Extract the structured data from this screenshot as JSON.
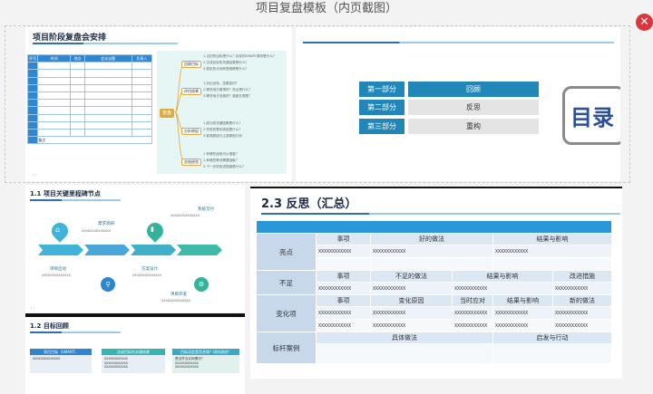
{
  "window": {
    "title": "项目复盘模板（内页截图）",
    "close_glyph": "✕"
  },
  "slide1": {
    "title": "项目阶段复盘会安排",
    "table_headers": [
      "序号",
      "时间",
      "地点",
      "会议议题",
      "负责人"
    ],
    "table_footer_label": "备注",
    "center_node": "复盘",
    "branches": [
      {
        "label": "回顾目标",
        "items": [
          "1.当初的目标是什么？目标的SMART原则是什么？",
          "2.达成目标的关键结果是什么？",
          "3.原定的计划和里程碑是什么？"
        ]
      },
      {
        "label": "评估结果",
        "items": [
          "1.对比目标，结果如何？",
          "2.哪些地方做得好？亮点是什么？",
          "3.哪些地方没做好？差距在哪里？"
        ]
      },
      {
        "label": "分析原因",
        "items": [
          "1.成功的关键因素是什么？",
          "2.失败的根本原因是什么？",
          "3.客观原因与主观原因分析"
        ]
      },
      {
        "label": "总结经验",
        "items": [
          "1.有哪些经验可以借鉴？",
          "2.有哪些教训需要吸取？",
          "3.下一步的改进措施是什么？"
        ]
      }
    ],
    "pager": "‹ ›"
  },
  "slide2": {
    "toc_title": "目录",
    "items": [
      {
        "num": "第一部分",
        "label": "回顾"
      },
      {
        "num": "第二部分",
        "label": "反思"
      },
      {
        "num": "第三部分",
        "label": "重构"
      }
    ]
  },
  "slide3": {
    "title": "1.1 项目关键里程碑节点",
    "milestones": [
      {
        "label": "项目启动",
        "x": "XXXXXXXXXXXXXX"
      },
      {
        "label": "需求调研",
        "x": "XXXXXXXXXXXXXX"
      },
      {
        "label": "方案设计",
        "x": "XXXXXXXXXXXXXX"
      },
      {
        "label": "项目开发",
        "x": "XXXXXXXXXXXXXX"
      },
      {
        "label": "系统交付",
        "x": "XXXXXXXXXXXXXX"
      }
    ],
    "pager": "‹ ›"
  },
  "slide4": {
    "title": "2.3 反思（汇总）",
    "sections": [
      {
        "row": "亮点",
        "cols": [
          "事项",
          "好的做法",
          "结果与影响"
        ],
        "cell": "XXXXXXXXXXXX"
      },
      {
        "row": "不足",
        "cols": [
          "事项",
          "不足的做法",
          "结果与影响",
          "改进措施"
        ],
        "cell": "XXXXXXXXXXXX"
      },
      {
        "row": "变化项",
        "cols": [
          "事项",
          "变化原因",
          "当时应对",
          "结果与影响",
          "新的做法"
        ],
        "cell": "XXXXXXXXXXXX"
      },
      {
        "row": "标杆案例",
        "cols": [
          "具体做法",
          "启发与行动"
        ],
        "cell": ""
      }
    ]
  },
  "slide5": {
    "title": "1.2 目标回顾",
    "boxes": [
      {
        "head": "项目目标（SMART）",
        "lines": [
          "XXXXXXXXXXXXXX"
        ]
      },
      {
        "head": "达成目标的关键结果",
        "lines": [
          "XXXXXXXXXXXX",
          "XXXXXXXXXXXX",
          "XXXXXXXXXXXX"
        ]
      },
      {
        "head": "目标设定是否合理？如何改进？",
        "lines": [
          "是否符合实际情况？",
          "XXXXXXXXXXXX",
          "XXXXXXXXXXXX"
        ]
      }
    ],
    "colors": {
      "box1": "#2e86d1",
      "box2": "#36b4b4",
      "box3": "#3aa9c6"
    }
  }
}
